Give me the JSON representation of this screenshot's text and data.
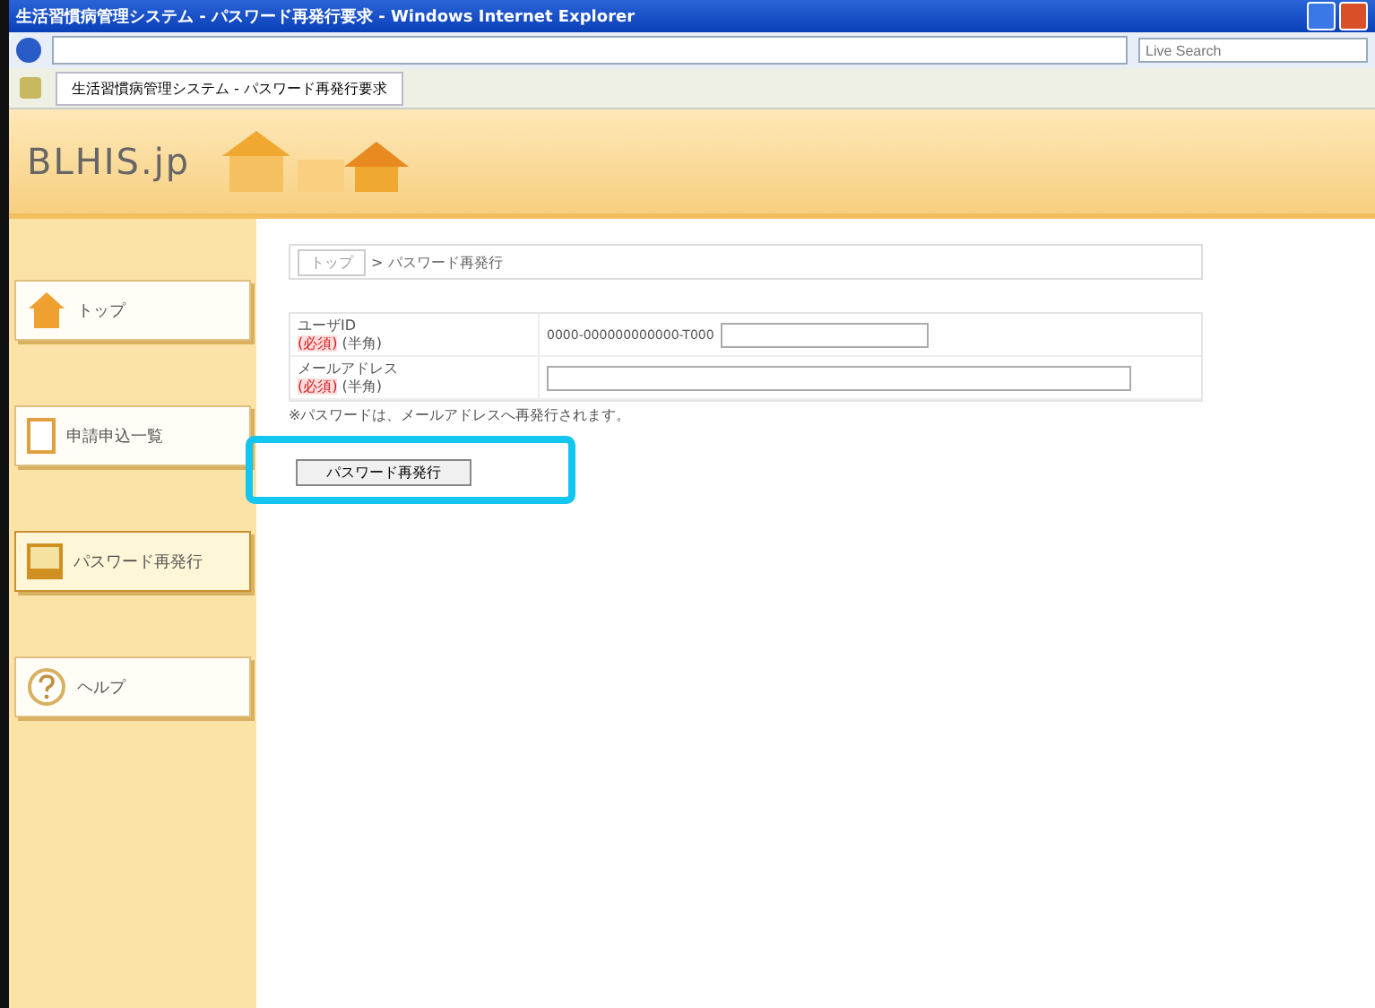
{
  "window": {
    "title": "生活習慣病管理システム - パスワード再発行要求 - Windows Internet Explorer"
  },
  "browser": {
    "tab_title": "生活習慣病管理システム - パスワード再発行要求",
    "search_placeholder": "Live Search"
  },
  "site": {
    "logo": "BLHIS.jp"
  },
  "sidebar": {
    "items": [
      {
        "label": "トップ",
        "kind": "house",
        "selected": false
      },
      {
        "label": "申請申込一覧",
        "kind": "document",
        "selected": false
      },
      {
        "label": "パスワード再発行",
        "kind": "book",
        "selected": true
      },
      {
        "label": "ヘルプ",
        "kind": "help",
        "selected": false
      }
    ]
  },
  "breadcrumb": {
    "separator": ">",
    "items": [
      "トップ",
      "パスワード再発行"
    ]
  },
  "form": {
    "fields": [
      {
        "label": "ユーザID",
        "required": "(必須)",
        "note": "(半角)",
        "prefix": "0000-000000000000-T000"
      },
      {
        "label": "メールアドレス",
        "required": "(必須)",
        "note": "(半角)"
      }
    ],
    "notice": "※パスワードは、メールアドレスへ再発行されます。",
    "submit": "パスワード再発行"
  },
  "highlight": {
    "on": true
  }
}
